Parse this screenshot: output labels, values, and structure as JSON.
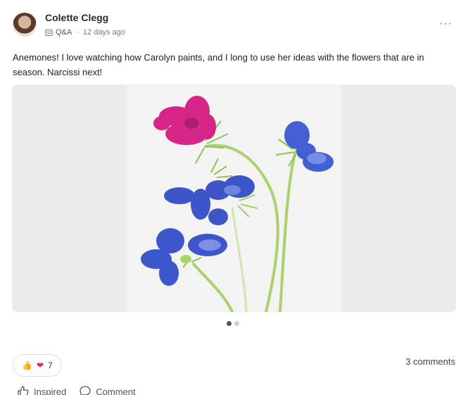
{
  "post": {
    "author": "Colette Clegg",
    "category": "Q&A",
    "separator": "·",
    "time": "12 days ago",
    "more_label": "···",
    "text": "Anemones! I love watching how Carolyn paints, and I long to use her ideas with the flowers that are in season. Narcissi next!",
    "carousel": {
      "total": 2,
      "active": 1
    },
    "reactions": {
      "thumbs_icon": "👍",
      "heart_icon": "❤",
      "count": "7"
    },
    "comments": "3 comments",
    "actions": {
      "inspired": "Inspired",
      "comment": "Comment"
    }
  },
  "colors": {
    "magenta": "#d4157e",
    "blue": "#2946c6",
    "stem": "#9fcf5a"
  }
}
